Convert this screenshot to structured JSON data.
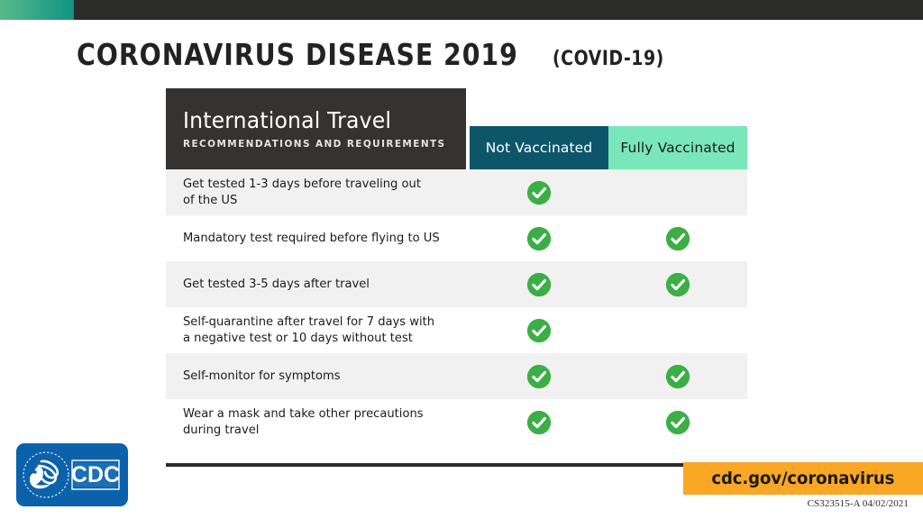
{
  "top_bar": {
    "accent_color_start": "#58b98a",
    "accent_color_end": "#0f9484",
    "bar_color": "#2b2b2a"
  },
  "title": {
    "main": "CORONAVIRUS DISEASE 2019",
    "sub": "(COVID-19)"
  },
  "table": {
    "header": {
      "title": "International Travel",
      "subtitle": "RECOMMENDATIONS AND REQUIREMENTS",
      "title_bg": "#343332",
      "columns": [
        {
          "label": "Not Vaccinated",
          "bg": "#0d566a",
          "fg": "#ffffff"
        },
        {
          "label": "Fully Vaccinated",
          "bg": "#79e7b9",
          "fg": "#1b1b1b"
        }
      ]
    },
    "check_color": "#3bae45",
    "rows": [
      {
        "lines": [
          "Get tested 1-3 days before traveling out",
          "of the US"
        ],
        "not_vaccinated": true,
        "fully_vaccinated": false,
        "striped": true
      },
      {
        "lines": [
          "Mandatory test required before flying to US"
        ],
        "not_vaccinated": true,
        "fully_vaccinated": true,
        "striped": false
      },
      {
        "lines": [
          "Get tested 3-5 days after travel"
        ],
        "not_vaccinated": true,
        "fully_vaccinated": true,
        "striped": true
      },
      {
        "lines": [
          "Self-quarantine after travel for 7 days with",
          "a negative test or 10 days without test"
        ],
        "not_vaccinated": true,
        "fully_vaccinated": false,
        "striped": false
      },
      {
        "lines": [
          "Self-monitor for symptoms"
        ],
        "not_vaccinated": true,
        "fully_vaccinated": true,
        "striped": true
      },
      {
        "lines": [
          "Wear a mask and take other precautions",
          "during travel"
        ],
        "not_vaccinated": true,
        "fully_vaccinated": true,
        "striped": false
      }
    ]
  },
  "footer": {
    "logo_text": "CDC",
    "logo_bg": "#0b62ab",
    "url": "cdc.gov/coronavirus",
    "url_bg": "#f9a724",
    "doc_code": "CS323515-A 04/02/2021"
  }
}
